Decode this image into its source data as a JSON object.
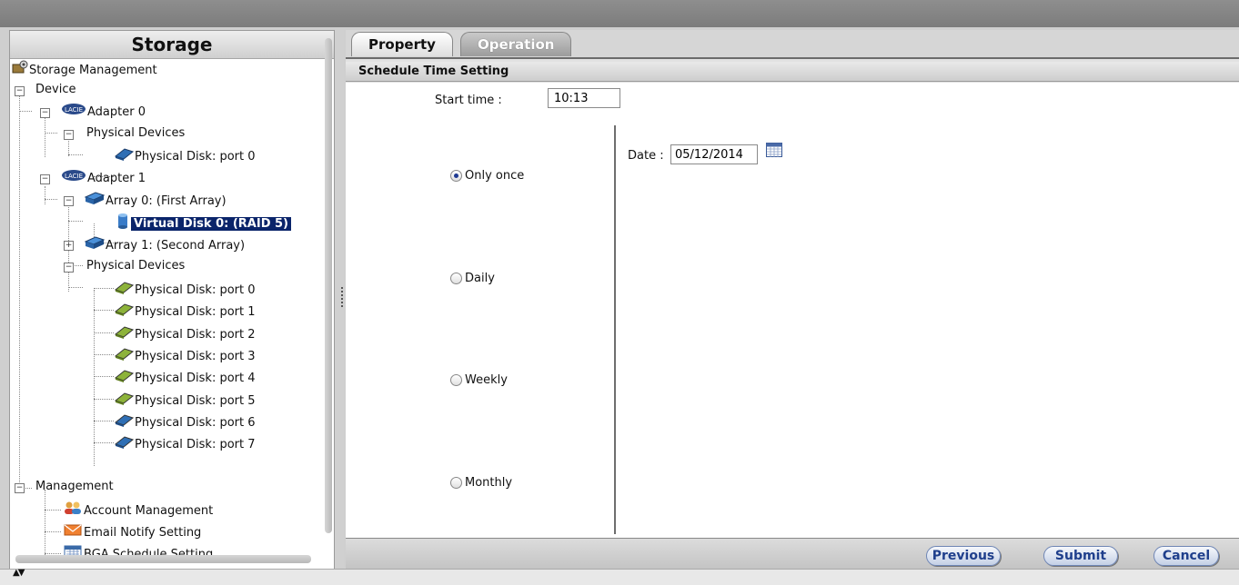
{
  "left": {
    "title": "Storage",
    "tree": {
      "storage_management": "Storage Management",
      "device": "Device",
      "adapter0": "Adapter 0",
      "adapter0_physical_devices": "Physical Devices",
      "adapter0_disk_port0": "Physical Disk: port 0",
      "adapter1": "Adapter 1",
      "array0": "Array 0: (First Array)",
      "virtual_disk0": "Virtual Disk 0: (RAID 5)",
      "array1": "Array 1: (Second Array)",
      "adapter1_physical_devices": "Physical Devices",
      "adapter1_disks": [
        "Physical Disk: port 0",
        "Physical Disk: port 1",
        "Physical Disk: port 2",
        "Physical Disk: port 3",
        "Physical Disk: port 4",
        "Physical Disk: port 5",
        "Physical Disk: port 6",
        "Physical Disk: port 7"
      ],
      "management": "Management",
      "account_management": "Account Management",
      "email_notify": "Email Notify Setting",
      "bga_schedule": "BGA Schedule Setting"
    },
    "adapter_badge": "LACIE"
  },
  "tabs": {
    "property": "Property",
    "operation": "Operation"
  },
  "section": {
    "title": "Schedule Time Setting"
  },
  "schedule": {
    "start_label": "Start time :",
    "start_value": "10:13",
    "options": [
      "Only once",
      "Daily",
      "Weekly",
      "Monthly"
    ],
    "selected": "Only once",
    "date_label": "Date :",
    "date_value": "05/12/2014"
  },
  "footer": {
    "previous": "Previous",
    "submit": "Submit",
    "cancel": "Cancel"
  },
  "colors": {
    "selection": "#0a246a",
    "button_text": "#1f3f8c",
    "disk_green": "#8db33a",
    "disk_blue": "#2f6fb5"
  }
}
